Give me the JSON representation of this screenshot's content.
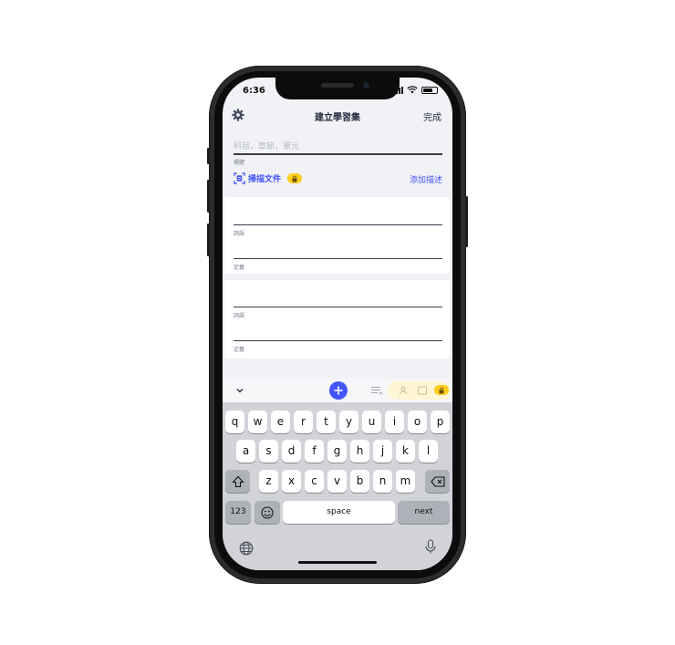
{
  "status": {
    "time": "6:36"
  },
  "header": {
    "title": "建立學習集",
    "done_label": "完成"
  },
  "form": {
    "subject_placeholder": "科目，章節，單元",
    "title_label": "標題",
    "scan_label": "掃描文件",
    "add_description_label": "添加描述"
  },
  "cards": [
    {
      "term_label": "詞語",
      "definition_label": "定義"
    },
    {
      "term_label": "詞語",
      "definition_label": "定義"
    }
  ],
  "keyboard": {
    "row1": [
      "q",
      "w",
      "e",
      "r",
      "t",
      "y",
      "u",
      "i",
      "o",
      "p"
    ],
    "row2": [
      "a",
      "s",
      "d",
      "f",
      "g",
      "h",
      "j",
      "k",
      "l"
    ],
    "row3": [
      "z",
      "x",
      "c",
      "v",
      "b",
      "n",
      "m"
    ],
    "numbers_label": "123",
    "space_label": "space",
    "next_label": "next"
  },
  "colors": {
    "accent": "#4255ff",
    "premium_badge": "#ffcd1f",
    "text_dark": "#2b2d42"
  },
  "icons": [
    "gear-icon",
    "scan-icon",
    "lock-icon",
    "chevron-down-icon",
    "plus-icon",
    "format-icon",
    "image-icon",
    "emoji-icon",
    "shift-icon",
    "backspace-icon",
    "globe-icon",
    "microphone-icon"
  ]
}
